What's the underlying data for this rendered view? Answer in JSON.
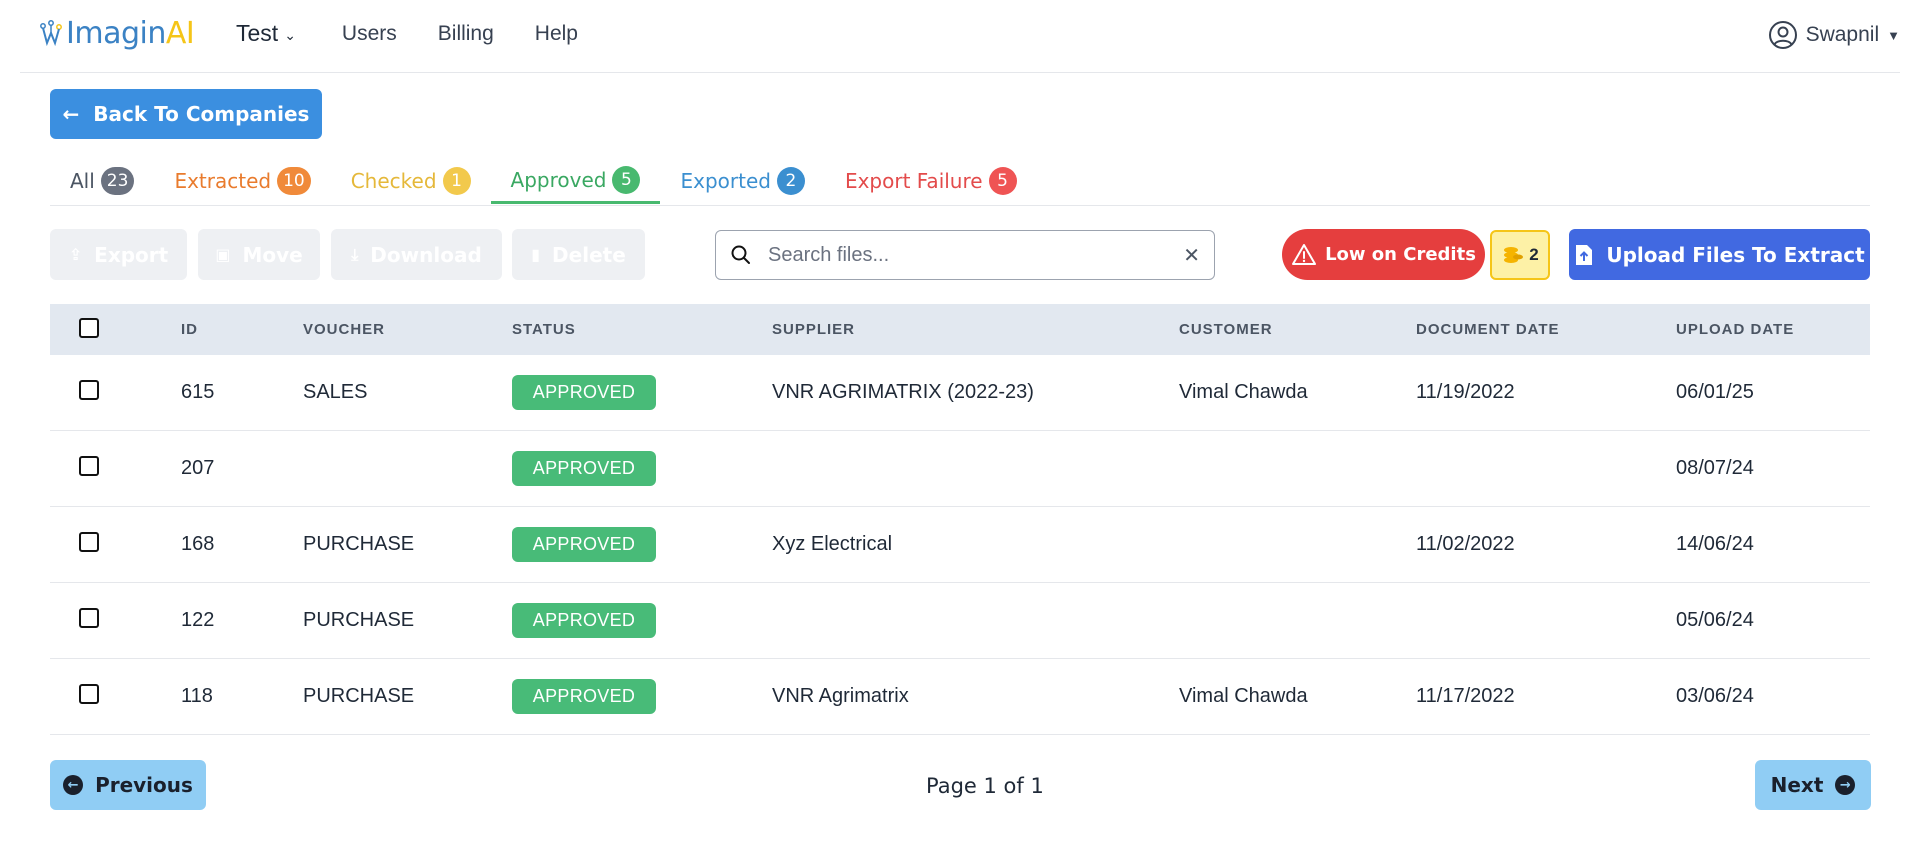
{
  "brand": {
    "name_part1": "Imagin",
    "name_part2": "AI"
  },
  "nav": {
    "company": "Test",
    "links": [
      "Users",
      "Billing",
      "Help"
    ],
    "user": "Swapnil"
  },
  "back_button": "Back To Companies",
  "tabs": [
    {
      "label": "All",
      "count": "23"
    },
    {
      "label": "Extracted",
      "count": "10"
    },
    {
      "label": "Checked",
      "count": "1"
    },
    {
      "label": "Approved",
      "count": "5"
    },
    {
      "label": "Exported",
      "count": "2"
    },
    {
      "label": "Export Failure",
      "count": "5"
    }
  ],
  "active_tab": "Approved",
  "toolbar": {
    "export": "Export",
    "move": "Move",
    "download": "Download",
    "delete": "Delete",
    "search_placeholder": "Search files...",
    "search_value": "",
    "low_credits": "Low on Credits",
    "credit_count": "2",
    "upload": "Upload Files To Extract"
  },
  "table": {
    "headers": [
      "ID",
      "VOUCHER",
      "STATUS",
      "SUPPLIER",
      "CUSTOMER",
      "DOCUMENT DATE",
      "UPLOAD DATE"
    ],
    "rows": [
      {
        "id": "615",
        "voucher": "SALES",
        "status": "APPROVED",
        "supplier": "VNR AGRIMATRIX (2022-23)",
        "customer": "Vimal Chawda",
        "document_date": "11/19/2022",
        "upload_date": "06/01/25"
      },
      {
        "id": "207",
        "voucher": "",
        "status": "APPROVED",
        "supplier": "",
        "customer": "",
        "document_date": "",
        "upload_date": "08/07/24"
      },
      {
        "id": "168",
        "voucher": "PURCHASE",
        "status": "APPROVED",
        "supplier": "Xyz Electrical",
        "customer": "",
        "document_date": "11/02/2022",
        "upload_date": "14/06/24"
      },
      {
        "id": "122",
        "voucher": "PURCHASE",
        "status": "APPROVED",
        "supplier": "",
        "customer": "",
        "document_date": "",
        "upload_date": "05/06/24"
      },
      {
        "id": "118",
        "voucher": "PURCHASE",
        "status": "APPROVED",
        "supplier": "VNR Agrimatrix",
        "customer": "Vimal Chawda",
        "document_date": "11/17/2022",
        "upload_date": "03/06/24"
      }
    ]
  },
  "pagination": {
    "previous": "Previous",
    "next": "Next",
    "page_info": "Page 1 of 1"
  },
  "colors": {
    "primary": "#3b8fe0",
    "upload": "#4169e1",
    "danger": "#e53e3e",
    "approved": "#48bb78",
    "pagination": "#90cdf4"
  }
}
